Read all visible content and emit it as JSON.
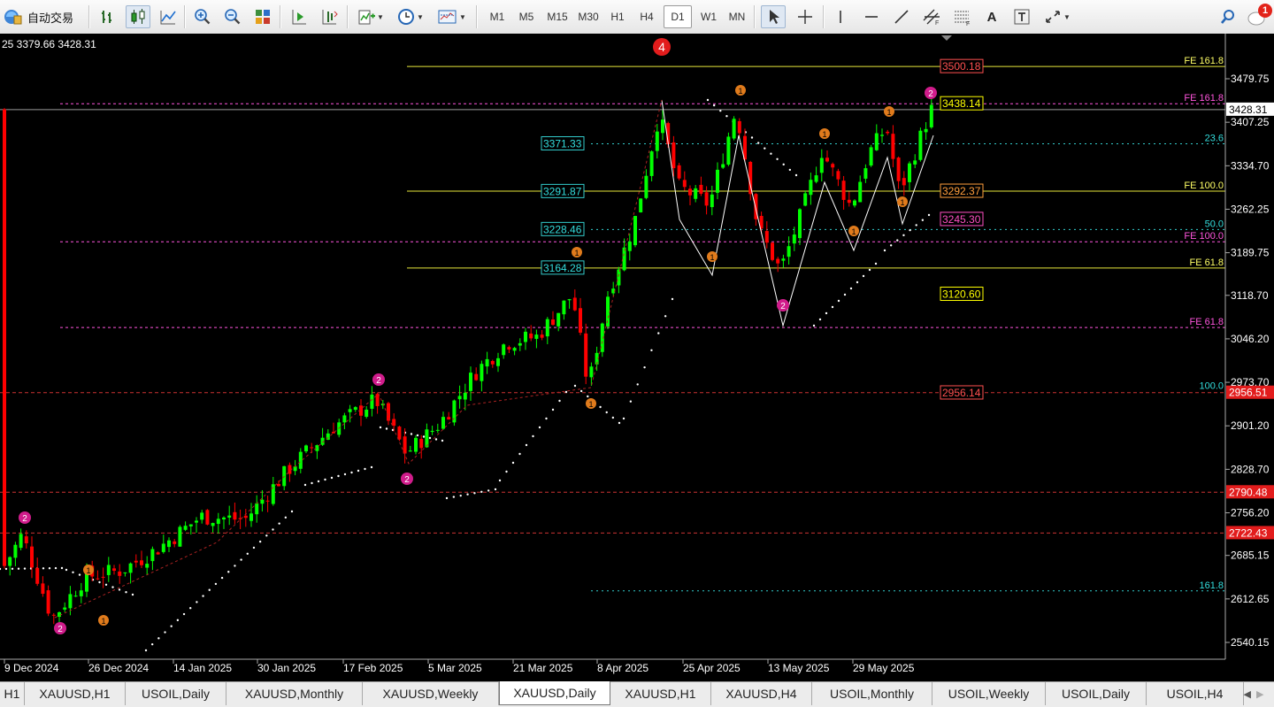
{
  "toolbar": {
    "auto_trade_label": "自动交易",
    "timeframes": [
      "M1",
      "M5",
      "M15",
      "M30",
      "H1",
      "H4",
      "D1",
      "W1",
      "MN"
    ],
    "active_timeframe": "D1",
    "notification_count": "1"
  },
  "chart": {
    "info_line": "25 3379.66 3428.31",
    "current_price": "3428.31",
    "price_axis": [
      "3479.75",
      "3407.25",
      "3334.70",
      "3262.25",
      "3189.75",
      "3118.70",
      "3046.20",
      "2973.70",
      "2901.20",
      "2828.70",
      "2756.20",
      "2685.15",
      "2612.65",
      "2540.15"
    ],
    "time_axis": [
      "9 Dec 2024",
      "26 Dec 2024",
      "14 Jan 2025",
      "30 Jan 2025",
      "17 Feb 2025",
      "5 Mar 2025",
      "21 Mar 2025",
      "8 Apr 2025",
      "25 Apr 2025",
      "13 May 2025",
      "29 May 2025"
    ],
    "red_price_labels": [
      "2956.51",
      "2790.48",
      "2722.43"
    ],
    "level_labels": [
      {
        "text": "3500.18",
        "color": "#ff5050"
      },
      {
        "text": "3438.14",
        "color": "#ffff00"
      },
      {
        "text": "3292.37",
        "color": "#ff9e3d"
      },
      {
        "text": "3245.30",
        "color": "#ff4fc4"
      },
      {
        "text": "2956.14",
        "color": "#ff5050"
      },
      {
        "text": "3120.60",
        "color": "#ffff00"
      }
    ],
    "fib_left_labels": [
      "3371.33",
      "3291.87",
      "3228.46",
      "3164.28"
    ],
    "fib_right_labels": [
      {
        "text": "FE 161.8",
        "color": "#ffff66"
      },
      {
        "text": "FE 161.8",
        "color": "#ff55dd"
      },
      {
        "text": "23.6",
        "color": "#33dddd"
      },
      {
        "text": "FE 100.0",
        "color": "#ffff66"
      },
      {
        "text": "50.0",
        "color": "#33dddd"
      },
      {
        "text": "FE 100.0",
        "color": "#ff55dd"
      },
      {
        "text": "FE 61.8",
        "color": "#ffff66"
      },
      {
        "text": "FE 61.8",
        "color": "#ff55dd"
      },
      {
        "text": "100.0",
        "color": "#33dddd"
      },
      {
        "text": "161.8",
        "color": "#33dddd"
      }
    ],
    "wave_labels": {
      "major": "4",
      "two": "2",
      "one": "1"
    },
    "colors": {
      "bull": "#00ff00",
      "bear": "#ff0000",
      "background": "#000000",
      "wave": "#ffffff"
    }
  },
  "tabs": {
    "items": [
      "H1",
      "XAUUSD,H1",
      "USOIL,Daily",
      "XAUUSD,Monthly",
      "XAUUSD,Weekly",
      "XAUUSD,Daily",
      "XAUUSD,H1",
      "XAUUSD,H4",
      "USOIL,Monthly",
      "USOIL,Weekly",
      "USOIL,Daily",
      "USOIL,H4"
    ],
    "active_index": 5
  }
}
